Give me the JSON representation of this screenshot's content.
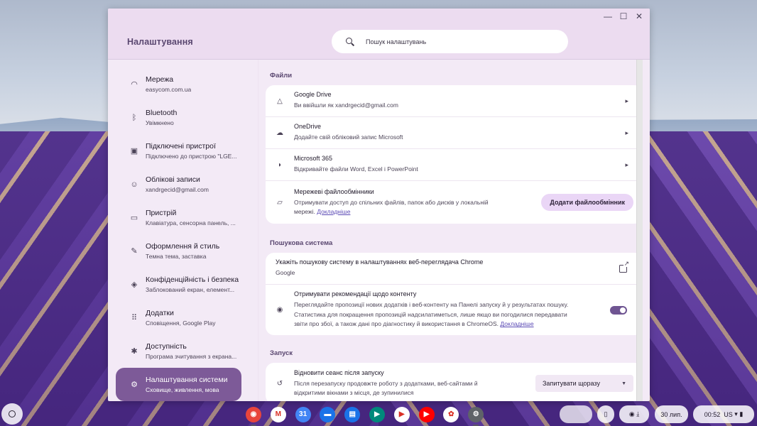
{
  "window": {
    "controls": {
      "minimize": "—",
      "maximize": "☐",
      "close": "✕"
    }
  },
  "header": {
    "title": "Налаштування",
    "search_placeholder": "Пошук налаштувань"
  },
  "sidebar": {
    "items": [
      {
        "label": "Мережа",
        "sub": "easycom.com.ua",
        "icon": "wifi-icon",
        "glyph": "◠",
        "active": false
      },
      {
        "label": "Bluetooth",
        "sub": "Увімкнено",
        "icon": "bluetooth-icon",
        "glyph": "ᛒ",
        "active": false
      },
      {
        "label": "Підключені пристрої",
        "sub": "Підключено до пристрою \"LGE...",
        "icon": "connected-devices-icon",
        "glyph": "▣",
        "active": false
      },
      {
        "label": "Облікові записи",
        "sub": "xandrgecid@gmail.com",
        "icon": "account-icon",
        "glyph": "☺",
        "active": false
      },
      {
        "label": "Пристрій",
        "sub": "Клавіатура, сенсорна панель, ...",
        "icon": "laptop-icon",
        "glyph": "▭",
        "active": false
      },
      {
        "label": "Оформлення й стиль",
        "sub": "Темна тема, заставка",
        "icon": "paintbrush-icon",
        "glyph": "✎",
        "active": false
      },
      {
        "label": "Конфіденційність і безпека",
        "sub": "Заблокований екран, елемент...",
        "icon": "shield-icon",
        "glyph": "◈",
        "active": false
      },
      {
        "label": "Додатки",
        "sub": "Сповіщення, Google Play",
        "icon": "apps-grid-icon",
        "glyph": "⠿",
        "active": false
      },
      {
        "label": "Доступність",
        "sub": "Програма зчитування з екрана...",
        "icon": "accessibility-icon",
        "glyph": "✱",
        "active": false
      },
      {
        "label": "Налаштування системи",
        "sub": "Сховище, живлення, мова",
        "icon": "gear-icon",
        "glyph": "⚙",
        "active": true
      }
    ]
  },
  "files": {
    "title": "Файли",
    "google_drive": {
      "title": "Google Drive",
      "sub": "Ви ввійшли як xandrgecid@gmail.com"
    },
    "onedrive": {
      "title": "OneDrive",
      "sub": "Додайте свій обліковий запис Microsoft"
    },
    "ms365": {
      "title": "Microsoft 365",
      "sub": "Відкривайте файли Word, Excel і PowerPoint"
    },
    "network_shares": {
      "title": "Мережеві файлообмінники",
      "sub_line1": "Отримувати доступ до спільних файлів, папок або дисків у локальній",
      "sub_line2": "мережі.",
      "link": "Докладніше",
      "button": "Додати файлообмінник"
    }
  },
  "search_engine": {
    "title": "Пошукова система",
    "row_title": "Укажіть пошукову систему в налаштуваннях веб-переглядача Chrome",
    "row_sub": "Google",
    "recommendations": {
      "title": "Отримувати рекомендації щодо контенту",
      "line1": "Переглядайте пропозиції нових додатків і веб-контенту на Панелі запуску й у результатах пошуку.",
      "line2": "Статистика для покращення пропозицій надсилатиметься, лише якщо ви погодилися передавати",
      "line3": "звіти про збої, а також дані про діагностику й використання в ChromeOS.",
      "link": "Докладніше",
      "enabled": true
    }
  },
  "startup": {
    "title": "Запуск",
    "row_title": "Відновити сеанс після запуску",
    "line1": "Після перезапуску продовжте роботу з додатками, веб-сайтами й",
    "line2": "відкритими вікнами з місця, де зупинилися",
    "dropdown_value": "Запитувати щоразу"
  },
  "shelf": {
    "apps": [
      {
        "name": "chrome-icon",
        "color": "#e8453c",
        "glyph": "◉",
        "open": true
      },
      {
        "name": "gmail-icon",
        "color": "#ffffff",
        "glyph": "M",
        "open": false
      },
      {
        "name": "calendar-icon",
        "color": "#4285f4",
        "glyph": "31",
        "open": false
      },
      {
        "name": "files-icon",
        "color": "#1a73e8",
        "glyph": "▬",
        "open": false
      },
      {
        "name": "messages-icon",
        "color": "#1a73e8",
        "glyph": "▤",
        "open": false
      },
      {
        "name": "meet-icon",
        "color": "#00897b",
        "glyph": "▶",
        "open": false
      },
      {
        "name": "play-store-icon",
        "color": "#ffffff",
        "glyph": "▶",
        "open": false
      },
      {
        "name": "youtube-icon",
        "color": "#ff0000",
        "glyph": "▶",
        "open": false
      },
      {
        "name": "photos-icon",
        "color": "#ffffff",
        "glyph": "✿",
        "open": false
      },
      {
        "name": "settings-app-icon",
        "color": "#5f6368",
        "glyph": "⚙",
        "open": true
      }
    ],
    "date": "30 лип.",
    "time": "00:52",
    "locale": "US"
  }
}
